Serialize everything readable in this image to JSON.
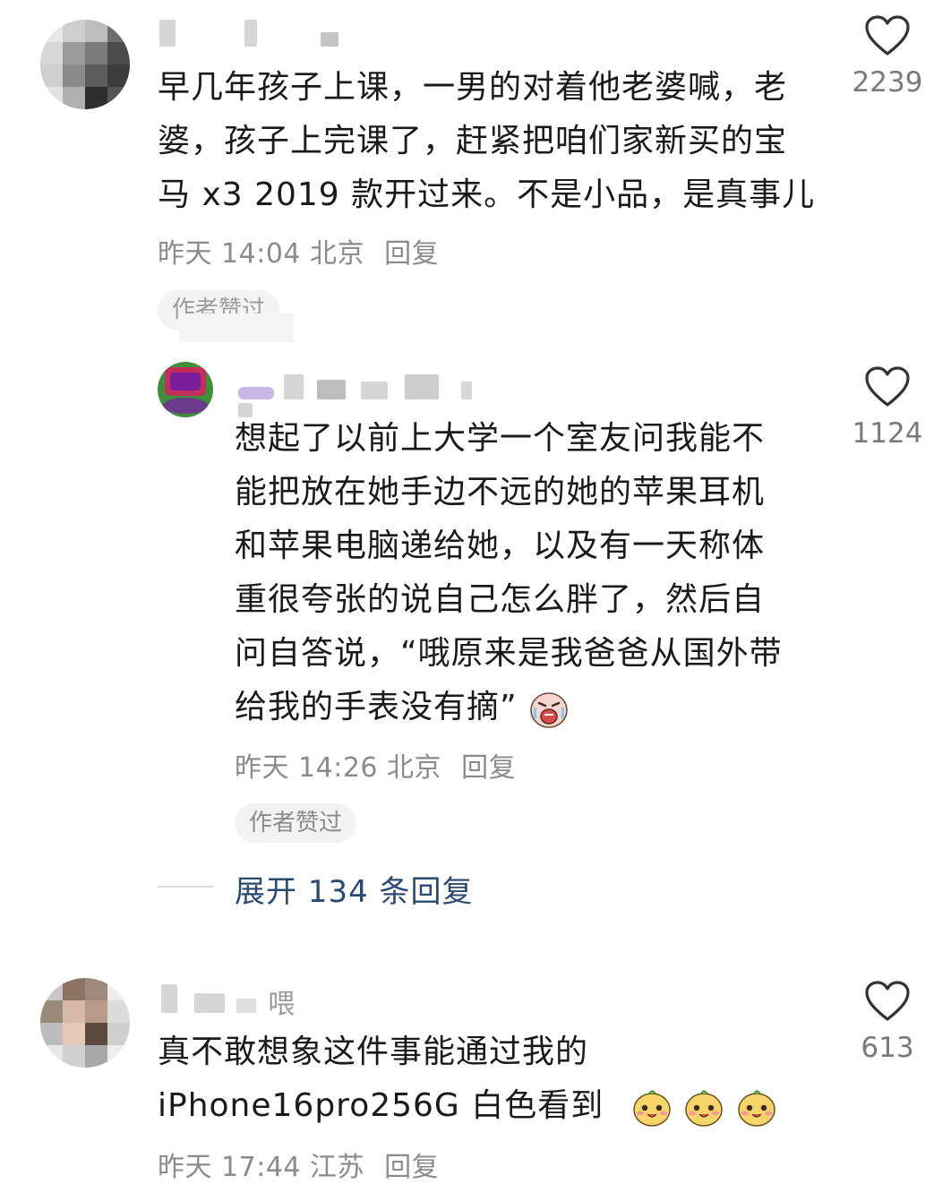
{
  "comments": [
    {
      "text_lines": [
        "早几年孩子上课，一男的对着他老婆喊，老",
        "婆，孩子上完课了，赶紧把咱们家新买的宝",
        "马 x3 2019 款开过来。不是小品，是真事儿"
      ],
      "time": "昨天 14:04",
      "location": "北京",
      "reply_label": "回复",
      "like_count": "2239",
      "author_like_badge": "作者赞过"
    },
    {
      "text_lines": [
        "想起了以前上大学一个室友问我能不",
        "能把放在她手边不远的她的苹果耳机",
        "和苹果电脑递给她，以及有一天称体",
        "重很夸张的说自己怎么胖了，然后自",
        "问自答说，“哦原来是我爸爸从国外带",
        "给我的手表没有摘”"
      ],
      "time": "昨天 14:26",
      "location": "北京",
      "reply_label": "回复",
      "like_count": "1124",
      "author_like_badge": "作者赞过",
      "trailing_emoji": "crying-face-emoji"
    },
    {
      "username_visible": "喂",
      "text_lines": [
        "真不敢想象这件事能通过我的",
        "iPhone16pro256G 白色看到"
      ],
      "time": "昨天 17:44",
      "location": "江苏",
      "reply_label": "回复",
      "like_count": "613",
      "trailing_emoji": "smug-face-emoji"
    }
  ],
  "expand_replies": "展开 134 条回复",
  "colors": {
    "text": "#1a1a1a",
    "meta": "#8b8b8b",
    "link": "#2a4a73",
    "badge_bg": "#f2f2f2"
  },
  "icons": {
    "like": "heart-outline-icon"
  }
}
